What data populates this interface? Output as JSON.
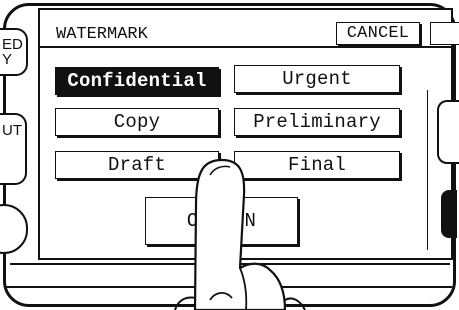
{
  "panel": {
    "title": "WATERMARK",
    "cancel_label": "CANCEL",
    "left_tab_a": [
      "ED",
      "Y"
    ],
    "left_tab_b": "UT"
  },
  "options": [
    {
      "label": "Confidential",
      "selected": true
    },
    {
      "label": "Urgent",
      "selected": false
    },
    {
      "label": "Copy",
      "selected": false
    },
    {
      "label": "Preliminary",
      "selected": false
    },
    {
      "label": "Draft",
      "selected": false
    },
    {
      "label": "Final",
      "selected": false
    }
  ],
  "on_button": {
    "label_left": "O",
    "label_right": "N"
  },
  "icons": [
    "pointing-finger-icon"
  ],
  "colors": {
    "ink": "#111111",
    "background": "#ffffff"
  }
}
